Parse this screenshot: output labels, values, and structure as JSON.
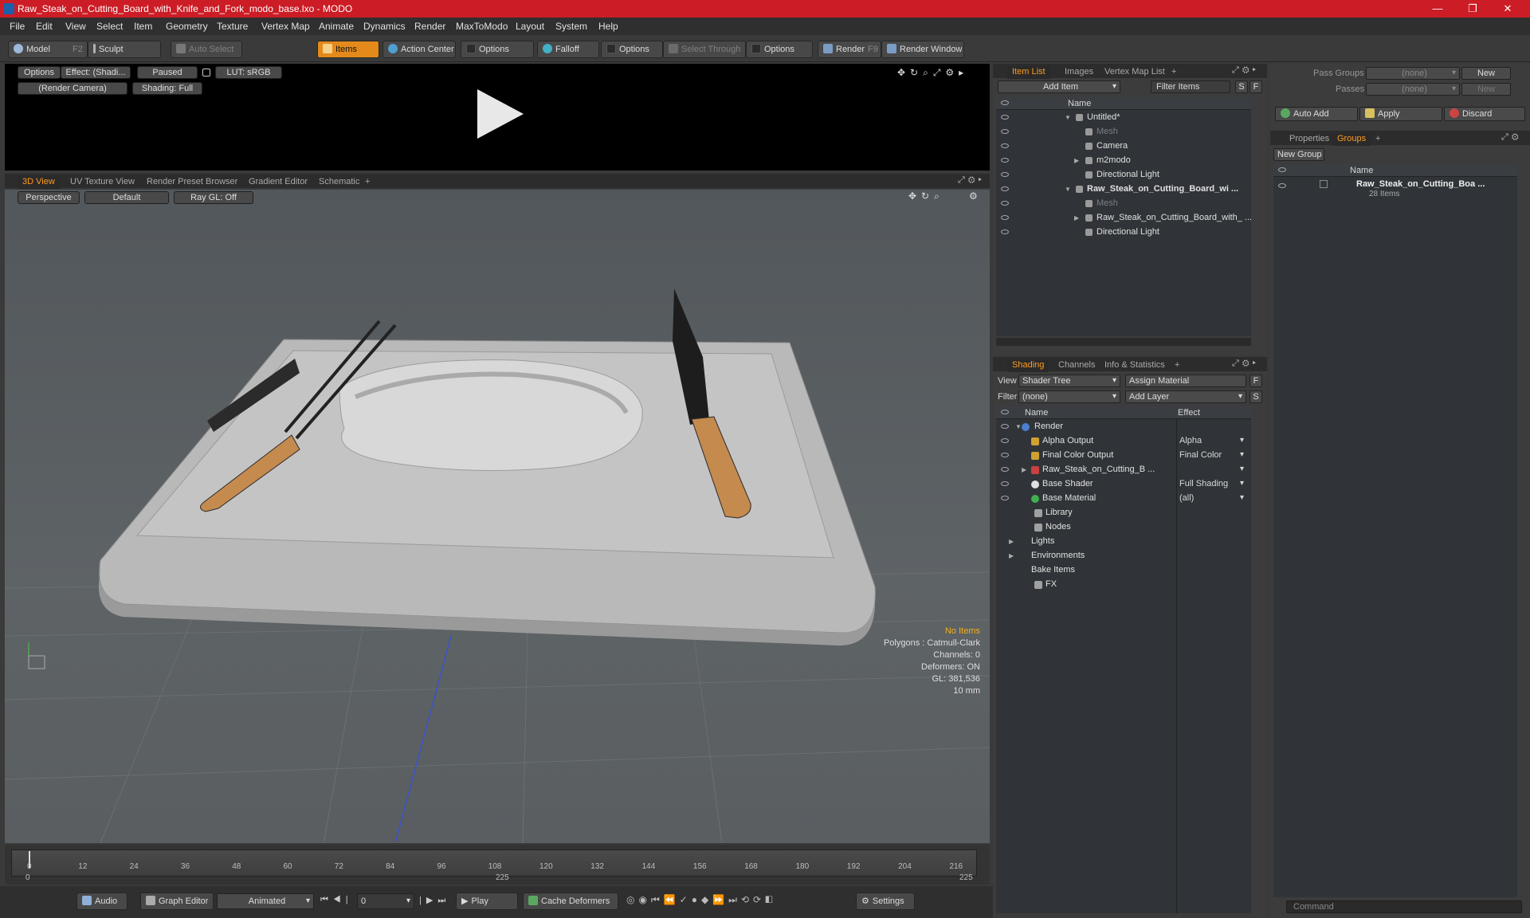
{
  "title": "Raw_Steak_on_Cutting_Board_with_Knife_and_Fork_modo_base.lxo - MODO",
  "window_controls": [
    "—",
    "❐",
    "✕"
  ],
  "menu": [
    "File",
    "Edit",
    "View",
    "Select",
    "Item",
    "Geometry",
    "Texture",
    "Vertex Map",
    "Animate",
    "Dynamics",
    "Render",
    "MaxToModo",
    "Layout",
    "System",
    "Help"
  ],
  "toolbar": {
    "model": "Model",
    "model_key": "F2",
    "sculpt": "Sculpt",
    "auto_select": "Auto Select",
    "items": "Items",
    "action_center": "Action Center",
    "options1": "Options",
    "falloff": "Falloff",
    "options2": "Options",
    "select_through": "Select Through",
    "options3": "Options",
    "render": "Render",
    "render_key": "F9",
    "render_window": "Render Window"
  },
  "preview": {
    "options": "Options",
    "effect": "Effect: (Shadi...",
    "paused": "Paused",
    "lut": "LUT: sRGB",
    "camera": "(Render Camera)",
    "shading": "Shading: Full"
  },
  "viewport_tabs": [
    "3D View",
    "UV Texture View",
    "Render Preset Browser",
    "Gradient Editor",
    "Schematic"
  ],
  "viewport_bar": {
    "perspective": "Perspective",
    "default": "Default",
    "raygl": "Ray GL: Off"
  },
  "hud": {
    "no_items": "No Items",
    "polygons": "Polygons : Catmull-Clark",
    "channels": "Channels: 0",
    "deformers": "Deformers: ON",
    "gl": "GL: 381,536",
    "scale": "10 mm"
  },
  "timeline": {
    "ticks": [
      "0",
      "12",
      "24",
      "36",
      "48",
      "60",
      "72",
      "84",
      "96",
      "108",
      "120",
      "132",
      "144",
      "156",
      "168",
      "180",
      "192",
      "204",
      "216"
    ],
    "lower": [
      "0",
      "225",
      "225"
    ]
  },
  "bottom": {
    "audio": "Audio",
    "graph_editor": "Graph Editor",
    "animated": "Animated",
    "frame": "0",
    "play": "Play",
    "cache": "Cache Deformers",
    "settings": "Settings"
  },
  "item_list": {
    "tabs": [
      "Item List",
      "Images",
      "Vertex Map List"
    ],
    "add_item": "Add Item",
    "filter": "Filter Items",
    "s": "S",
    "f": "F",
    "col_name": "Name",
    "rows": [
      {
        "label": "Untitled*",
        "indent": 0,
        "bold": false,
        "arrow": "▼",
        "dim": false
      },
      {
        "label": "Mesh",
        "indent": 1,
        "bold": false,
        "arrow": "",
        "dim": true
      },
      {
        "label": "Camera",
        "indent": 1,
        "bold": false,
        "arrow": "",
        "dim": false
      },
      {
        "label": "m2modo",
        "indent": 1,
        "bold": false,
        "arrow": "▶",
        "dim": false
      },
      {
        "label": "Directional Light",
        "indent": 1,
        "bold": false,
        "arrow": "",
        "dim": false
      },
      {
        "label": "Raw_Steak_on_Cutting_Board_wi ...",
        "indent": 0,
        "bold": true,
        "arrow": "▼",
        "dim": false
      },
      {
        "label": "Mesh",
        "indent": 1,
        "bold": false,
        "arrow": "",
        "dim": true
      },
      {
        "label": "Raw_Steak_on_Cutting_Board_with_ ...",
        "indent": 1,
        "bold": false,
        "arrow": "▶",
        "dim": false
      },
      {
        "label": "Directional Light",
        "indent": 1,
        "bold": false,
        "arrow": "",
        "dim": false
      }
    ]
  },
  "shading": {
    "tabs": [
      "Shading",
      "Channels",
      "Info & Statistics"
    ],
    "view_label": "View",
    "view_value": "Shader Tree",
    "assign": "Assign Material",
    "filter_label": "Filter",
    "filter_value": "(none)",
    "add_layer": "Add Layer",
    "col_name": "Name",
    "col_effect": "Effect",
    "rows": [
      {
        "label": "Render",
        "effect": "",
        "indent": 0,
        "arrow": "▼",
        "eye": true
      },
      {
        "label": "Alpha Output",
        "effect": "Alpha",
        "indent": 1,
        "arrow": "",
        "eye": true
      },
      {
        "label": "Final Color Output",
        "effect": "Final Color",
        "indent": 1,
        "arrow": "",
        "eye": true
      },
      {
        "label": "Raw_Steak_on_Cutting_B ...",
        "effect": "",
        "indent": 1,
        "arrow": "▶",
        "eye": true
      },
      {
        "label": "Base Shader",
        "effect": "Full Shading",
        "indent": 1,
        "arrow": "",
        "eye": true
      },
      {
        "label": "Base Material",
        "effect": "(all)",
        "indent": 1,
        "arrow": "",
        "eye": true
      },
      {
        "label": "Library",
        "effect": "",
        "indent": 0,
        "arrow": "",
        "eye": false
      },
      {
        "label": "Nodes",
        "effect": "",
        "indent": 0,
        "arrow": "",
        "eye": false
      },
      {
        "label": "Lights",
        "effect": "",
        "indent": -1,
        "arrow": "▶",
        "eye": false
      },
      {
        "label": "Environments",
        "effect": "",
        "indent": -1,
        "arrow": "▶",
        "eye": false
      },
      {
        "label": "Bake Items",
        "effect": "",
        "indent": -1,
        "arrow": "",
        "eye": false
      },
      {
        "label": "FX",
        "effect": "",
        "indent": 0,
        "arrow": "",
        "eye": false
      }
    ]
  },
  "groups": {
    "pass_groups": "Pass Groups",
    "pass_groups_val": "(none)",
    "new": "New",
    "passes": "Passes",
    "passes_val": "(none)",
    "new2": "New",
    "auto_add": "Auto Add",
    "apply": "Apply",
    "discard": "Discard",
    "tabs": [
      "Properties",
      "Groups"
    ],
    "new_group": "New Group",
    "col_name": "Name",
    "item": "Raw_Steak_on_Cutting_Boa ...",
    "count": "28 Items"
  },
  "command": "Command"
}
